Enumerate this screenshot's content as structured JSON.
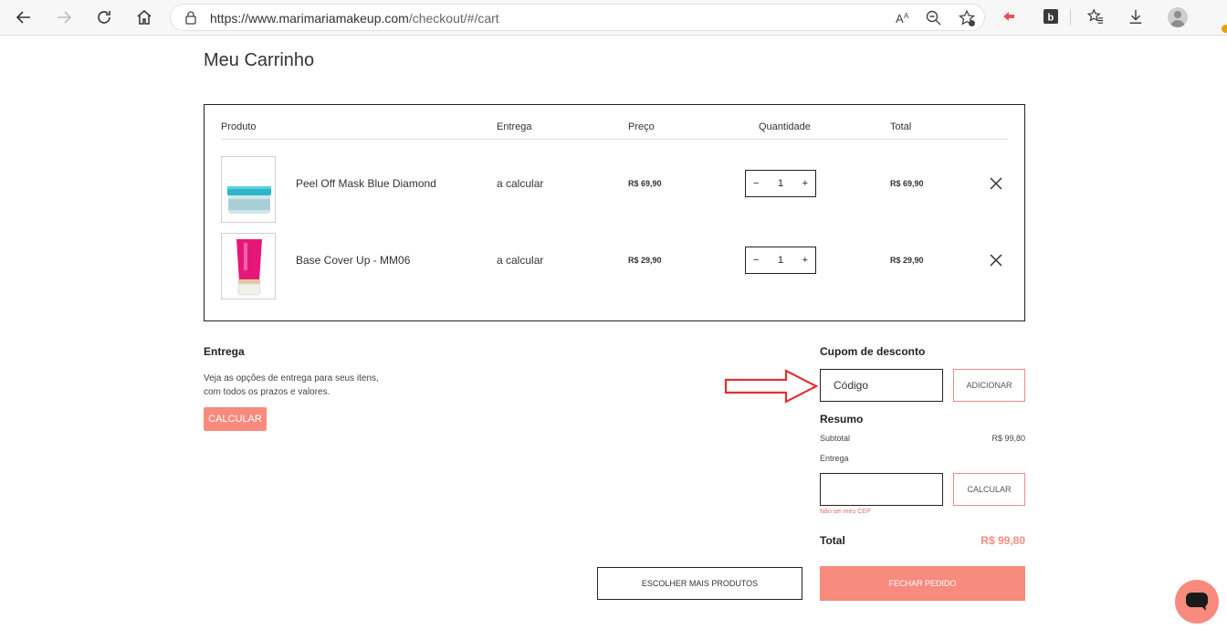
{
  "browser": {
    "url_host": "https://www.marimariamakeup.com",
    "url_path": "/checkout/#/cart"
  },
  "page": {
    "title": "Meu Carrinho"
  },
  "cart": {
    "columns": [
      "Produto",
      "Entrega",
      "Preço",
      "Quantidade",
      "Total"
    ],
    "items": [
      {
        "name": "Peel Off Mask Blue Diamond",
        "shipping": "a calcular",
        "price": "R$ 69,90",
        "quantity": "1",
        "total": "R$ 69,90"
      },
      {
        "name": "Base Cover Up - MM06",
        "shipping": "a calcular",
        "price": "R$ 29,90",
        "quantity": "1",
        "total": "R$ 29,90"
      }
    ],
    "minus_symbol": "−",
    "plus_symbol": "+"
  },
  "shipping": {
    "title": "Entrega",
    "description": "Veja as opções de entrega para seus itens, com todos os prazos e valores.",
    "button": "CALCULAR"
  },
  "coupon": {
    "title": "Cupom de desconto",
    "placeholder": "Código",
    "button": "ADICIONAR"
  },
  "summary": {
    "title": "Resumo",
    "subtotal_label": "Subtotal",
    "subtotal_value": "R$ 99,80",
    "shipping_label": "Entrega",
    "cep_button": "CALCULAR",
    "cep_link": "Não sei meu CEP",
    "total_label": "Total",
    "total_value": "R$ 99,80"
  },
  "actions": {
    "continue": "ESCOLHER MAIS PRODUTOS",
    "checkout": "FECHAR PEDIDO"
  },
  "colors": {
    "accent": "#f88a7e",
    "annotation_arrow": "#e03030"
  }
}
